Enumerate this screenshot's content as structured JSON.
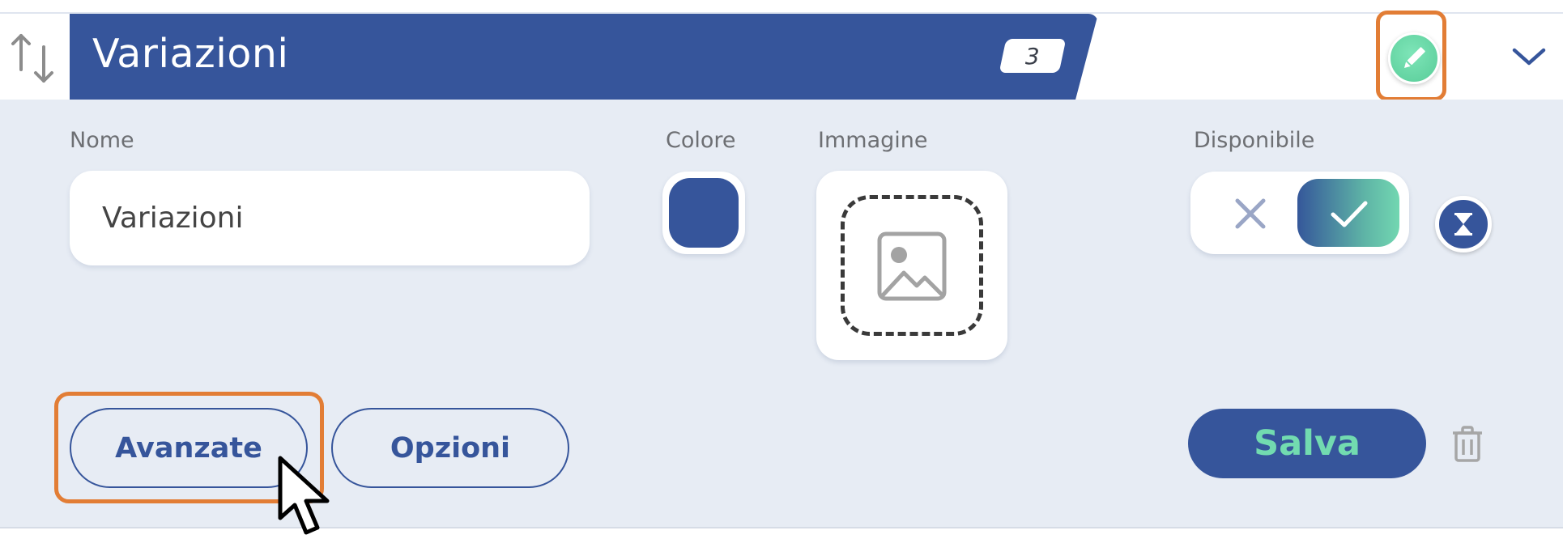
{
  "header": {
    "title": "Variazioni",
    "count": "3"
  },
  "form": {
    "name_label": "Nome",
    "name_value": "Variazioni",
    "color_label": "Colore",
    "color_value": "#36559b",
    "image_label": "Immagine",
    "available_label": "Disponibile",
    "available_state": "on"
  },
  "actions": {
    "advanced_label": "Avanzate",
    "options_label": "Opzioni",
    "save_label": "Salva"
  },
  "icons": [
    "sort-arrows-icon",
    "pencil-icon",
    "chevron-down-icon",
    "image-placeholder-icon",
    "close-icon",
    "check-icon",
    "hourglass-icon",
    "trash-icon",
    "mouse-cursor-icon"
  ],
  "colors": {
    "brand_blue": "#36559b",
    "accent_green": "#72dbb0",
    "highlight_orange": "#e27d35",
    "panel_bg": "#e7ecf4"
  }
}
